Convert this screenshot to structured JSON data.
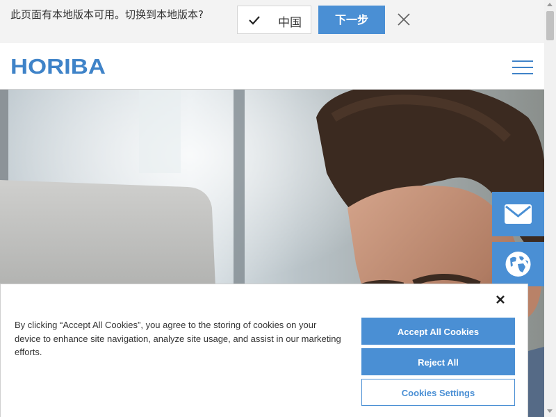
{
  "locale_banner": {
    "message": "此页面有本地版本可用。切换到本地版本?",
    "selected_country": "中国",
    "next_label": "下一步"
  },
  "header": {
    "logo": "HORIBA"
  },
  "side_buttons": {
    "icons": [
      "envelope-icon",
      "globe-icon"
    ]
  },
  "cookie_banner": {
    "text": "By clicking “Accept All Cookies”, you agree to the storing of cookies on your device to enhance site navigation, analyze site usage, and assist in our marketing efforts.",
    "accept_label": "Accept All Cookies",
    "reject_label": "Reject All",
    "settings_label": "Cookies Settings"
  },
  "colors": {
    "brand_blue": "#4a8fd4",
    "logo_blue": "#3f83c8"
  }
}
